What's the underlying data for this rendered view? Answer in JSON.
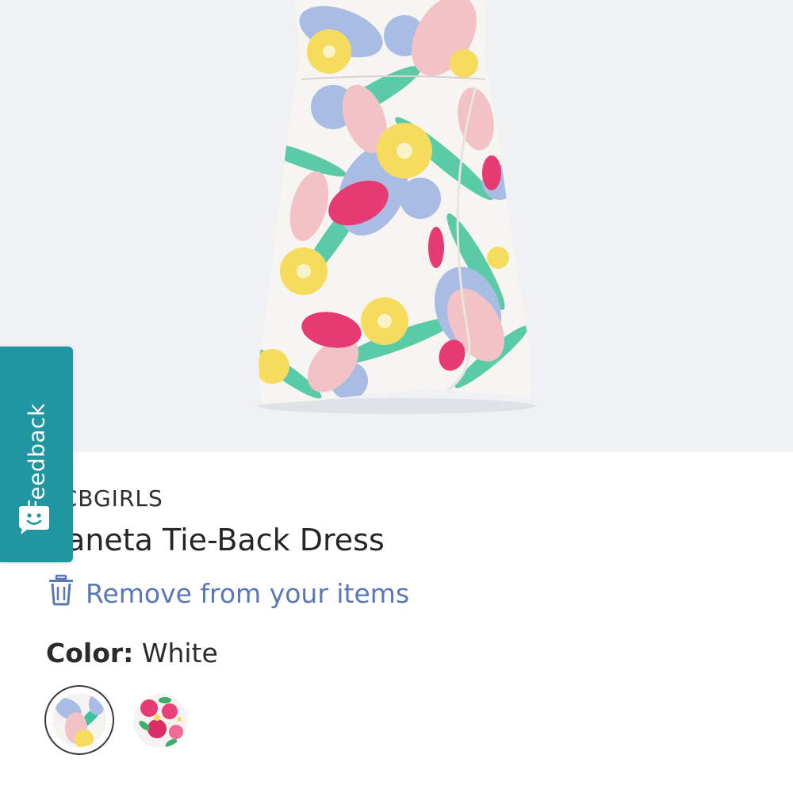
{
  "feedback": {
    "label": "Feedback"
  },
  "product": {
    "brand": "BCBGIRLS",
    "name": "Zaneta Tie-Back Dress",
    "remove_label": "Remove from your items",
    "color_label": "Color:",
    "color_value": "White",
    "swatches": [
      {
        "name": "White",
        "selected": true
      },
      {
        "name": "Pink floral",
        "selected": false
      }
    ]
  },
  "colors": {
    "accent": "#2097a0",
    "link": "#5a78b8",
    "hero_background": "#eff1f3"
  }
}
